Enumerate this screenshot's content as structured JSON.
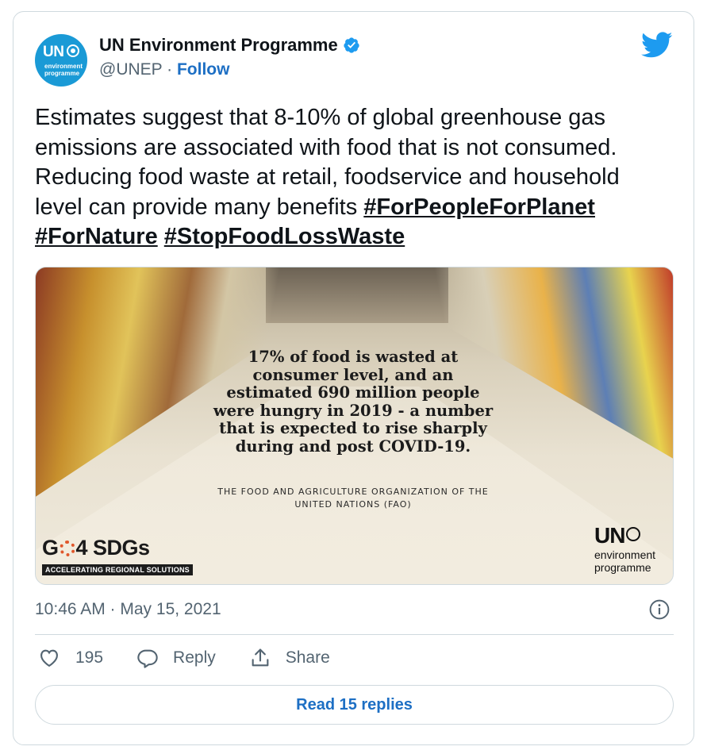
{
  "account": {
    "name": "UN Environment Programme",
    "handle": "@UNEP",
    "separator": " · ",
    "follow_label": "Follow",
    "avatar_text": "UN",
    "avatar_sub": "environment programme",
    "verified_icon": "verified-badge-icon"
  },
  "tweet": {
    "text": "Estimates suggest that 8-10% of global greenhouse gas emissions are associated with food that is not consumed. Reducing food waste at retail, foodservice and household level can provide many benefits ",
    "hashtags": [
      "#ForPeopleForPlanet",
      "#ForNature",
      "#StopFoodLossWaste"
    ]
  },
  "media": {
    "quote": "17% of food is wasted at consumer level, and an estimated 690 million people were hungry in 2019 - a number that is expected to rise sharply during and post COVID-19.",
    "source": "THE FOOD AND AGRICULTURE ORGANIZATION OF THE UNITED NATIONS (FAO)",
    "logo_left": "GO 4 SDGs",
    "logo_left_sub": "ACCELERATING REGIONAL SOLUTIONS",
    "logo_right_top": "UN",
    "logo_right_sub": "environment programme"
  },
  "meta": {
    "timestamp": "10:46 AM · May 15, 2021"
  },
  "actions": {
    "likes": "195",
    "reply_label": "Reply",
    "share_label": "Share"
  },
  "replies_button": "Read 15 replies",
  "colors": {
    "brand_blue": "#1d9bf0",
    "link_blue": "#1d6fc4",
    "muted": "#536471",
    "border": "#cfd9de"
  }
}
